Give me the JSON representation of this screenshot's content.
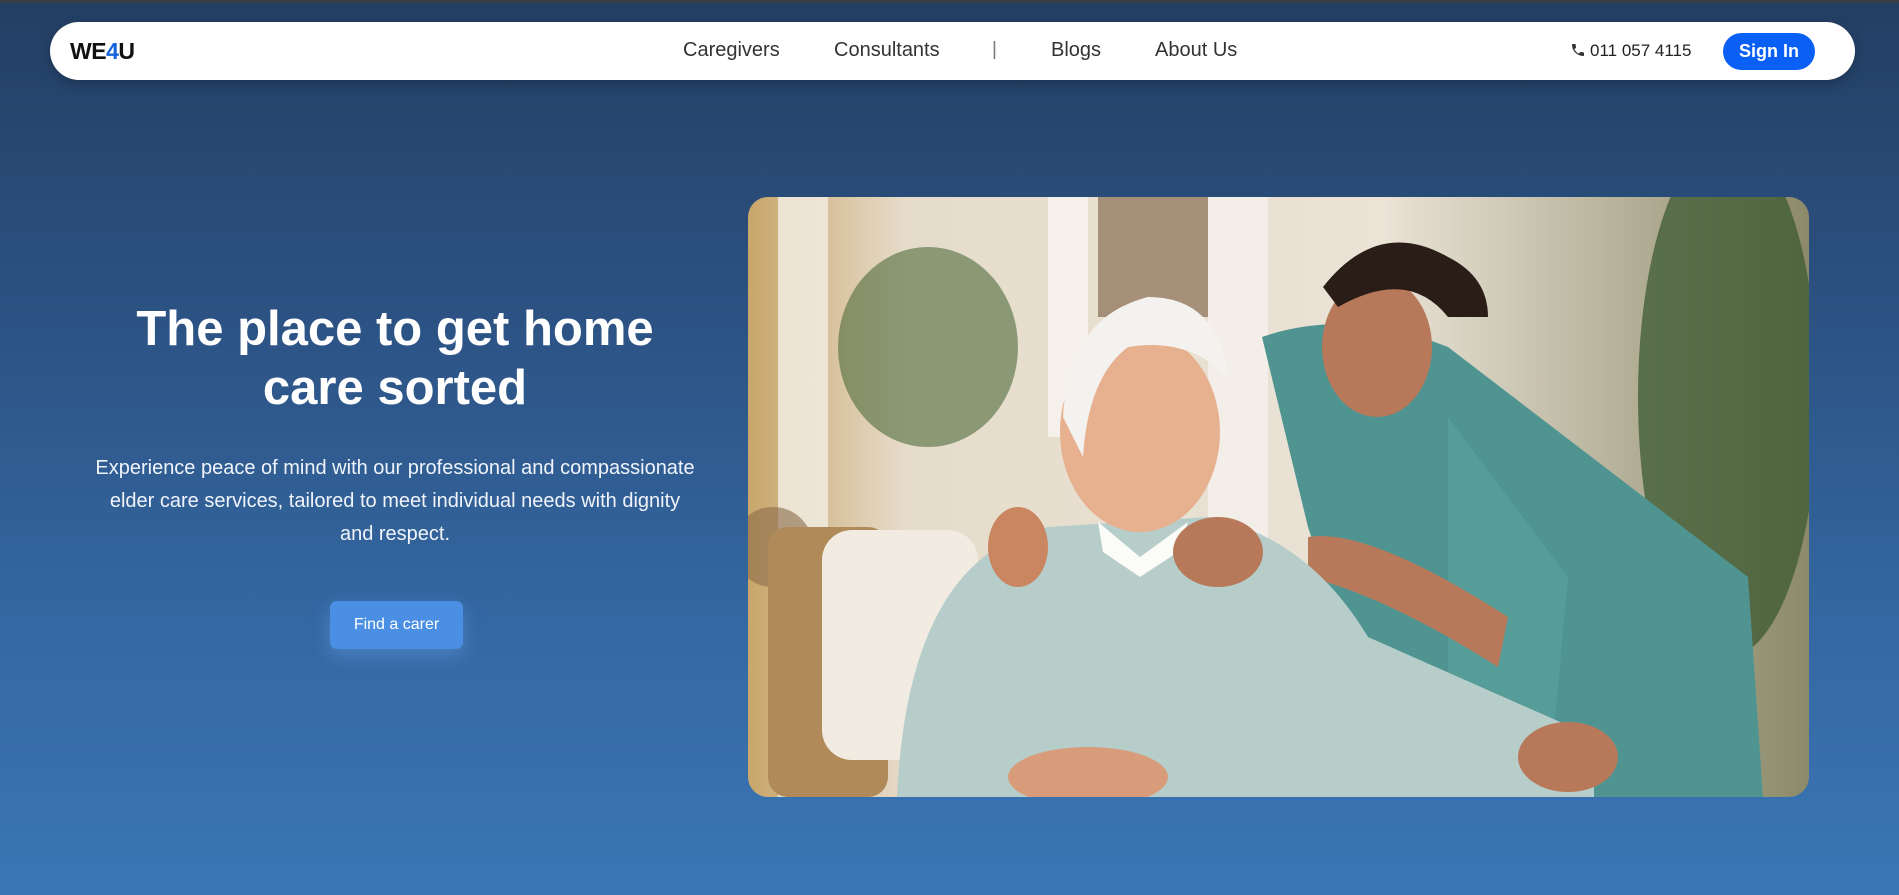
{
  "header": {
    "logo": {
      "prefix": "WE",
      "accent": "4",
      "suffix": "U"
    },
    "nav_links": [
      "Caregivers",
      "Consultants",
      "Blogs",
      "About Us"
    ],
    "separator": "|",
    "phone": "011 057 4115",
    "sign_in_label": "Sign In"
  },
  "hero": {
    "title": "The place to get home care sorted",
    "description": "Experience peace of mind with our professional and compassionate elder care services, tailored to meet individual needs with dignity and respect.",
    "cta_label": "Find a carer",
    "image_alt": "Caregiver with elderly woman"
  },
  "colors": {
    "accent": "#0a5ff5",
    "cta": "#4a8fe3",
    "logo_accent": "#1463d8"
  }
}
